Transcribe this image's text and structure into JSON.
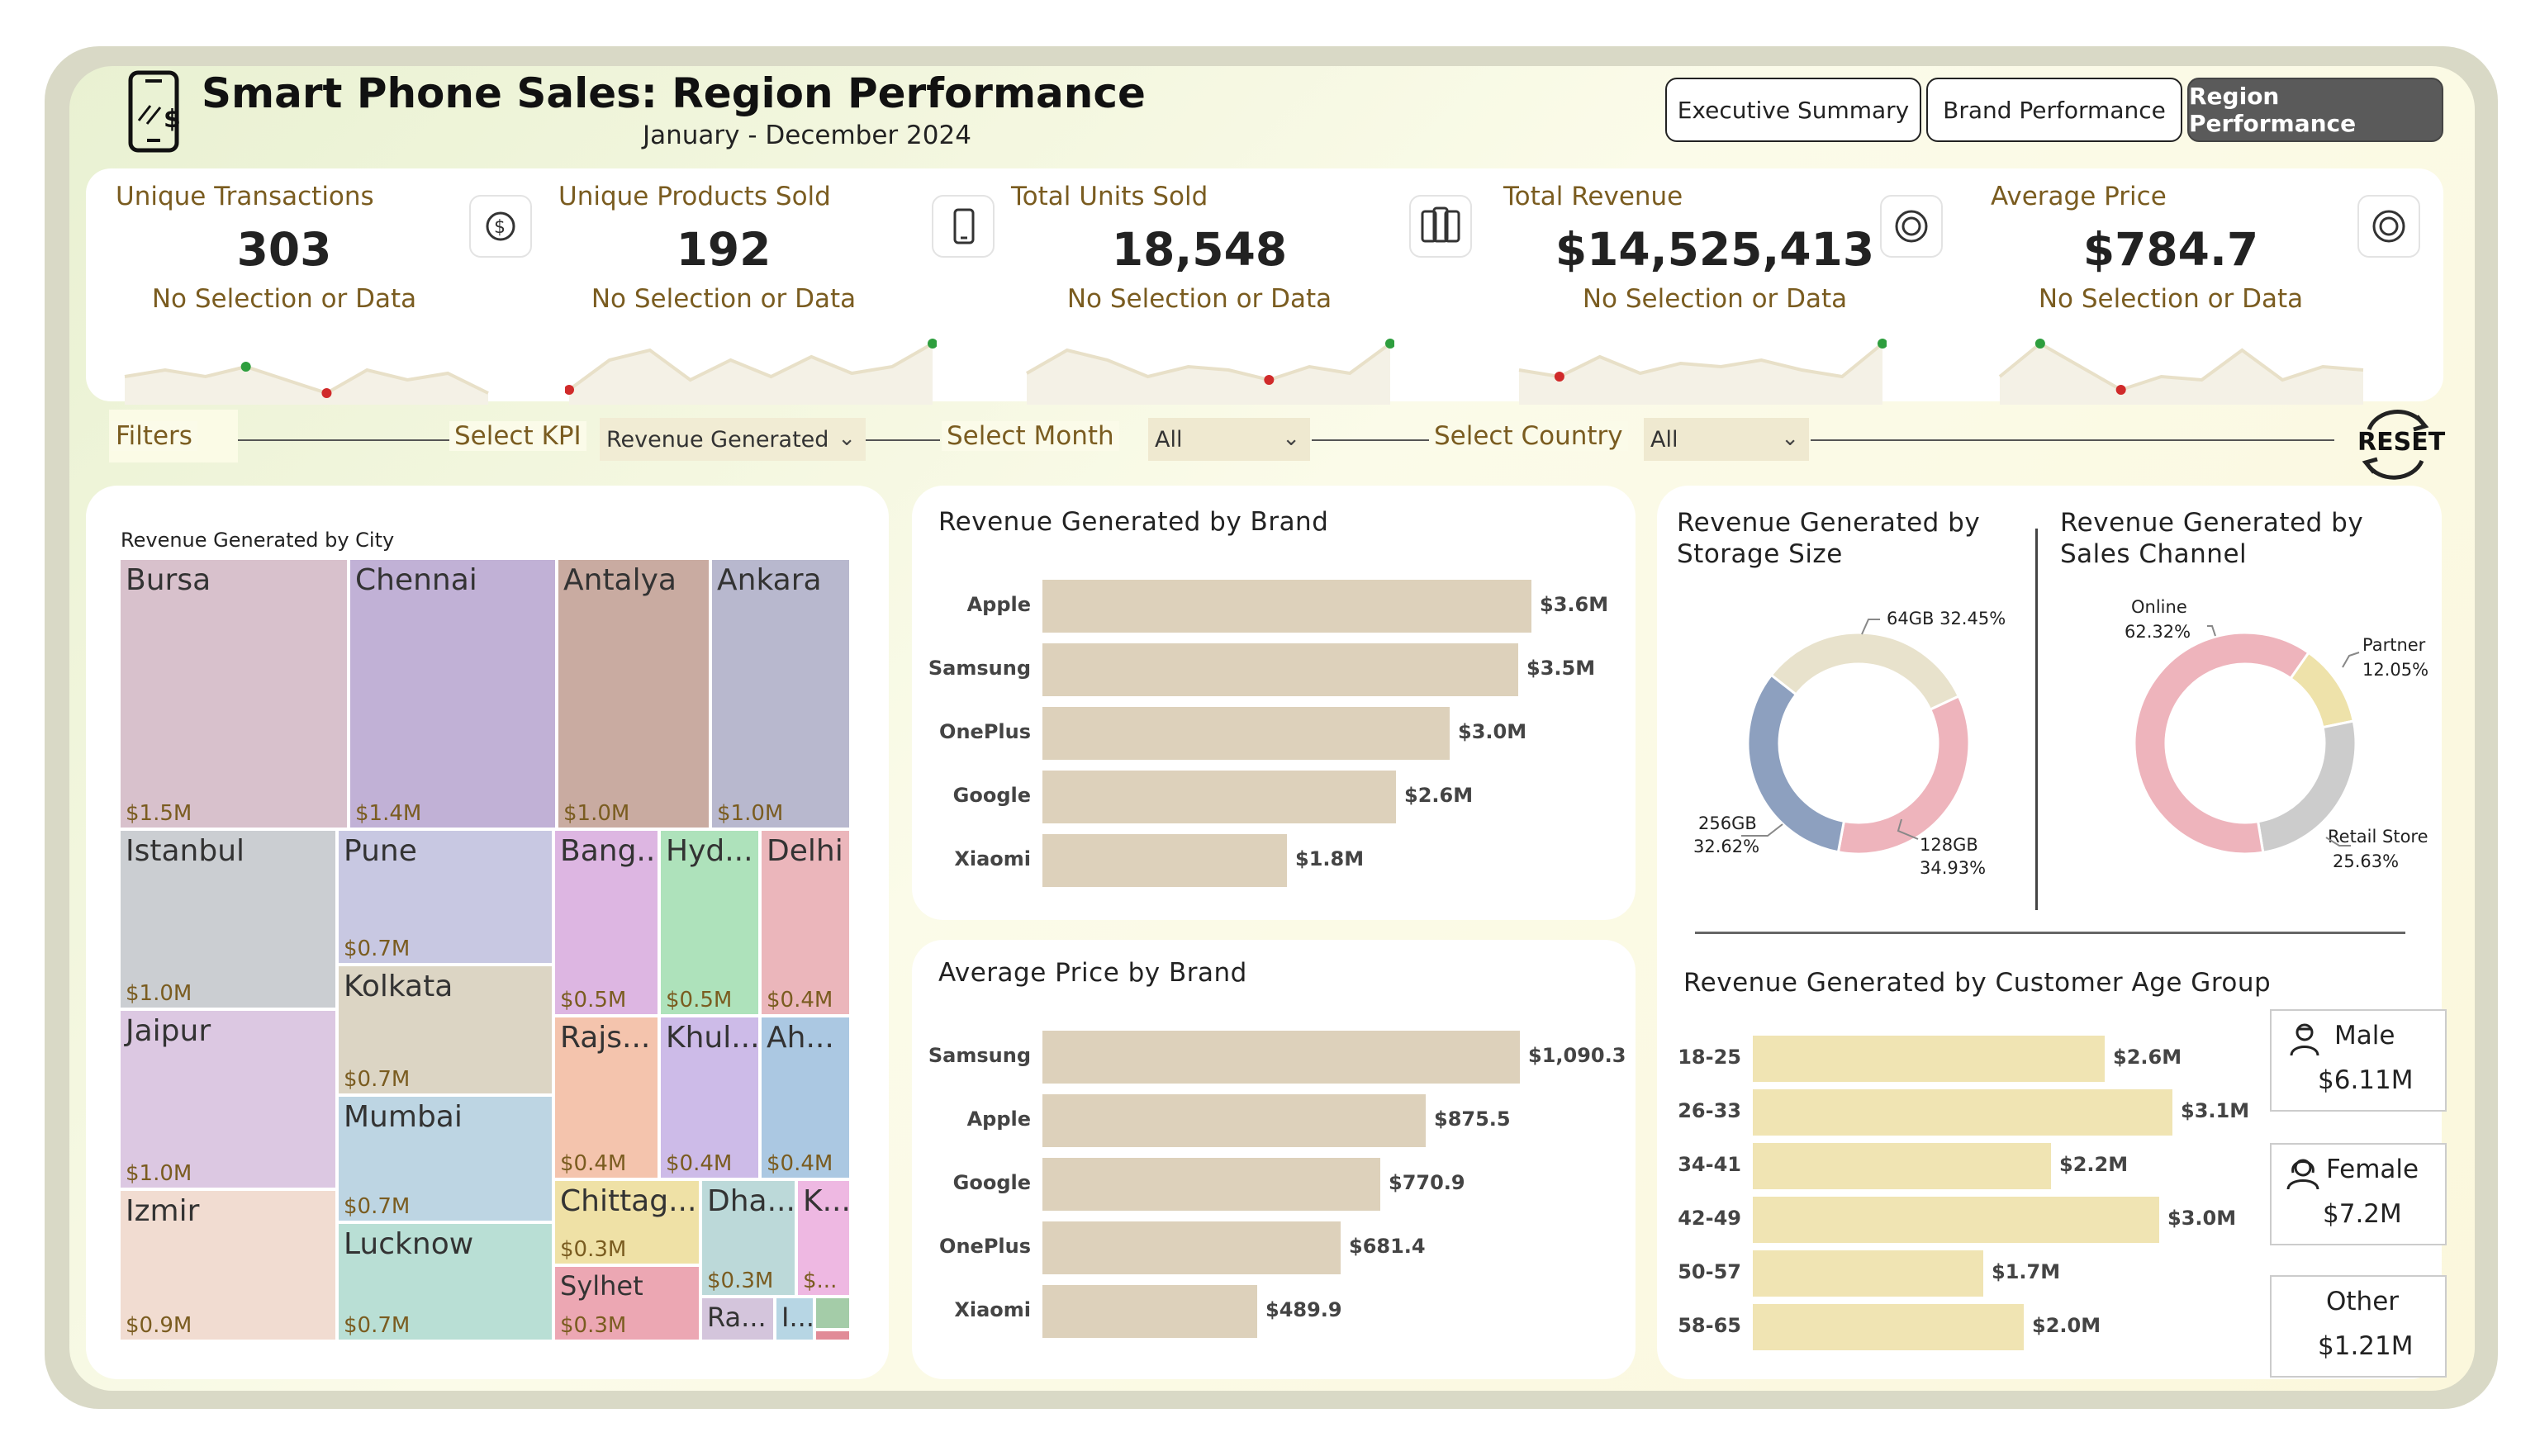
{
  "header": {
    "title": "Smart Phone Sales: Region Performance",
    "subtitle": "January - December 2024"
  },
  "nav": {
    "executive": "Executive Summary",
    "brand": "Brand Performance",
    "region": "Region Performance",
    "active": "Region Performance"
  },
  "kpis": [
    {
      "label": "Unique Transactions",
      "value": "303",
      "note": "No Selection or Data",
      "icon": "money-icon"
    },
    {
      "label": "Unique Products Sold",
      "value": "192",
      "note": "No Selection or Data",
      "icon": "phone-icon"
    },
    {
      "label": "Total Units Sold",
      "value": "18,548",
      "note": "No Selection or Data",
      "icon": "phones-icon"
    },
    {
      "label": "Total Revenue",
      "value": "$14,525,413",
      "note": "No Selection or Data",
      "icon": "coin-icon"
    },
    {
      "label": "Average Price",
      "value": "$784.7",
      "note": "No Selection or Data",
      "icon": "coin-icon"
    }
  ],
  "filters": {
    "title": "Filters",
    "kpi_label": "Select KPI",
    "kpi_value": "Revenue Generated",
    "month_label": "Select Month",
    "month_value": "All",
    "country_label": "Select Country",
    "country_value": "All",
    "reset": "RESET"
  },
  "colors": {
    "bar": "#ddd1bb",
    "age_bar": "#f0e4b3",
    "donut_64gb": "#e8e2cc",
    "donut_128gb": "#eeb4bc",
    "donut_256gb": "#8da0bf",
    "donut_online": "#eeb4bc",
    "donut_partner": "#eee2aa",
    "donut_retail": "#cccccc",
    "sparkline": "#e8e0c8",
    "point_green": "#2e9e3e",
    "point_red": "#d02a2a"
  },
  "treemap": {
    "title": "Revenue Generated by City",
    "cells": [
      {
        "name": "Bursa",
        "value": "$1.5M",
        "color": "#d8c1cc"
      },
      {
        "name": "Chennai",
        "value": "$1.4M",
        "color": "#c1b1d6"
      },
      {
        "name": "Antalya",
        "value": "$1.0M",
        "color": "#c9aba1"
      },
      {
        "name": "Ankara",
        "value": "$1.0M",
        "color": "#b8b8ce"
      },
      {
        "name": "Istanbul",
        "value": "$1.0M",
        "color": "#cbced2"
      },
      {
        "name": "Pune",
        "value": "$0.7M",
        "color": "#c8c8e2"
      },
      {
        "name": "Bang...",
        "value": "$0.5M",
        "color": "#ddb6e2"
      },
      {
        "name": "Hyd...",
        "value": "$0.5M",
        "color": "#aee2bb"
      },
      {
        "name": "Delhi",
        "value": "$0.4M",
        "color": "#ebb6bb"
      },
      {
        "name": "Kolkata",
        "value": "$0.7M",
        "color": "#dcd5c4"
      },
      {
        "name": "Jaipur",
        "value": "$1.0M",
        "color": "#dcc8e2"
      },
      {
        "name": "Rajs...",
        "value": "$0.4M",
        "color": "#f4c4ad"
      },
      {
        "name": "Khul...",
        "value": "$0.4M",
        "color": "#cdbbe8"
      },
      {
        "name": "Ah...",
        "value": "$0.4M",
        "color": "#abc8e2"
      },
      {
        "name": "Mumbai",
        "value": "$0.7M",
        "color": "#bdd5e3"
      },
      {
        "name": "Izmir",
        "value": "$0.9M",
        "color": "#f1dcd1"
      },
      {
        "name": "Chittag...",
        "value": "$0.3M",
        "color": "#efe1a6"
      },
      {
        "name": "Dha...",
        "value": "$0.3M",
        "color": "#bcd9d9"
      },
      {
        "name": "K...",
        "value": "$...",
        "color": "#eeb8e2"
      },
      {
        "name": "Lucknow",
        "value": "$0.7M",
        "color": "#b9dfd5"
      },
      {
        "name": "Sylhet",
        "value": "$0.3M",
        "color": "#eca7b3"
      },
      {
        "name": "Ra...",
        "value": "",
        "color": "#d4c5dc"
      },
      {
        "name": "I...",
        "value": "",
        "color": "#b7d6e4"
      },
      {
        "name": "",
        "value": "",
        "color": "#a4cca8"
      },
      {
        "name": "",
        "value": "",
        "color": "#e18b97"
      }
    ]
  },
  "brand_revenue": {
    "title": "Revenue Generated by Brand",
    "categories": [
      "Apple",
      "Samsung",
      "OnePlus",
      "Google",
      "Xiaomi"
    ],
    "values": [
      3.6,
      3.5,
      3.0,
      2.6,
      1.8
    ],
    "labels": [
      "$3.6M",
      "$3.5M",
      "$3.0M",
      "$2.6M",
      "$1.8M"
    ]
  },
  "brand_price": {
    "title": "Average Price by Brand",
    "categories": [
      "Samsung",
      "Apple",
      "Google",
      "OnePlus",
      "Xiaomi"
    ],
    "values": [
      1090.3,
      875.5,
      770.9,
      681.4,
      489.9
    ],
    "labels": [
      "$1,090.3",
      "$875.5",
      "$770.9",
      "$681.4",
      "$489.9"
    ]
  },
  "storage_donut": {
    "title": "Revenue Generated by Storage Size",
    "slices": [
      {
        "name": "64GB",
        "percent": 32.45,
        "label": "64GB 32.45%"
      },
      {
        "name": "128GB",
        "percent": 34.93,
        "label": "128GB",
        "pct_label": "34.93%"
      },
      {
        "name": "256GB",
        "percent": 32.62,
        "label": "256GB",
        "pct_label": "32.62%"
      }
    ]
  },
  "channel_donut": {
    "title": "Revenue Generated by Sales Channel",
    "slices": [
      {
        "name": "Partner",
        "percent": 12.05,
        "label": "Partner",
        "pct_label": "12.05%"
      },
      {
        "name": "Retail Store",
        "percent": 25.63,
        "label": "Retail Store",
        "pct_label": "25.63%"
      },
      {
        "name": "Online",
        "percent": 62.32,
        "label": "Online",
        "pct_label": "62.32%"
      }
    ]
  },
  "age_group": {
    "title": "Revenue Generated by Customer Age Group",
    "categories": [
      "18-25",
      "26-33",
      "34-41",
      "42-49",
      "50-57",
      "58-65"
    ],
    "values": [
      2.6,
      3.1,
      2.2,
      3.0,
      1.7,
      2.0
    ],
    "labels": [
      "$2.6M",
      "$3.1M",
      "$2.2M",
      "$3.0M",
      "$1.7M",
      "$2.0M"
    ]
  },
  "gender": {
    "male_label": "Male",
    "male_value": "$6.11M",
    "female_label": "Female",
    "female_value": "$7.2M",
    "other_label": "Other",
    "other_value": "$1.21M"
  },
  "sparklines": [
    [
      0.7,
      0.6,
      0.7,
      0.55,
      0.75,
      0.95,
      0.6,
      0.75,
      0.65,
      0.95
    ],
    [
      0.9,
      0.45,
      0.3,
      0.75,
      0.45,
      0.7,
      0.4,
      0.65,
      0.55,
      0.2
    ],
    [
      0.65,
      0.3,
      0.45,
      0.7,
      0.55,
      0.6,
      0.75,
      0.55,
      0.65,
      0.2
    ],
    [
      0.6,
      0.7,
      0.4,
      0.65,
      0.5,
      0.55,
      0.45,
      0.6,
      0.7,
      0.2
    ],
    [
      0.7,
      0.2,
      0.55,
      0.9,
      0.7,
      0.75,
      0.3,
      0.75,
      0.55,
      0.6
    ]
  ]
}
